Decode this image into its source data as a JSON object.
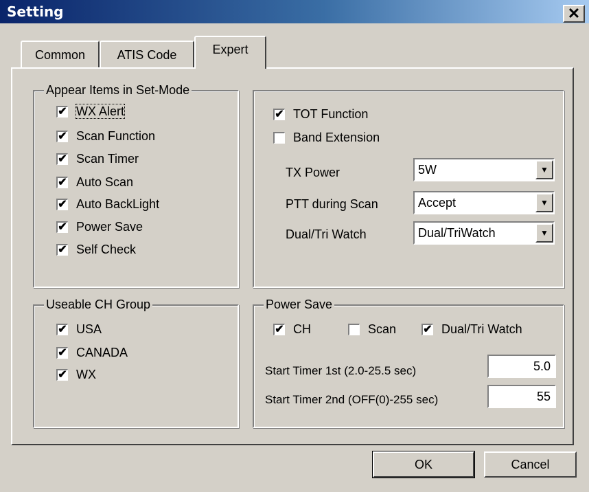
{
  "window": {
    "title": "Setting",
    "close_glyph": "✕"
  },
  "tabs": [
    {
      "label": "Common"
    },
    {
      "label": "ATIS Code"
    },
    {
      "label": "Expert",
      "active": true
    }
  ],
  "appear_items": {
    "legend": "Appear Items in Set-Mode",
    "items": [
      {
        "label": "WX Alert",
        "checked": true
      },
      {
        "label": "Scan Function",
        "checked": true
      },
      {
        "label": "Scan Timer",
        "checked": true
      },
      {
        "label": "Auto Scan",
        "checked": true
      },
      {
        "label": "Auto BackLight",
        "checked": true
      },
      {
        "label": "Power Save",
        "checked": true
      },
      {
        "label": "Self Check",
        "checked": true
      }
    ]
  },
  "expert": {
    "tot_function": {
      "label": "TOT Function",
      "checked": true
    },
    "band_extension": {
      "label": "Band Extension",
      "checked": false
    },
    "tx_power": {
      "label": "TX Power",
      "value": "5W"
    },
    "ptt_during_scan": {
      "label": "PTT during Scan",
      "value": "Accept"
    },
    "dual_tri_watch": {
      "label": "Dual/Tri Watch",
      "value": "Dual/TriWatch"
    }
  },
  "ch_group": {
    "legend": "Useable CH Group",
    "items": [
      {
        "label": "USA",
        "checked": true
      },
      {
        "label": "CANADA",
        "checked": true
      },
      {
        "label": "WX",
        "checked": true
      }
    ]
  },
  "power_save": {
    "legend": "Power Save",
    "ch": {
      "label": "CH",
      "checked": true
    },
    "scan": {
      "label": "Scan",
      "checked": false
    },
    "dual_tri": {
      "label": "Dual/Tri Watch",
      "checked": true
    },
    "timer1": {
      "label": "Start Timer 1st (2.0-25.5 sec)",
      "value": "5.0"
    },
    "timer2": {
      "label": "Start Timer 2nd (OFF(0)-255 sec)",
      "value": "55"
    }
  },
  "buttons": {
    "ok": "OK",
    "cancel": "Cancel"
  },
  "check_glyph": "✔",
  "dropdown_glyph": "▼"
}
